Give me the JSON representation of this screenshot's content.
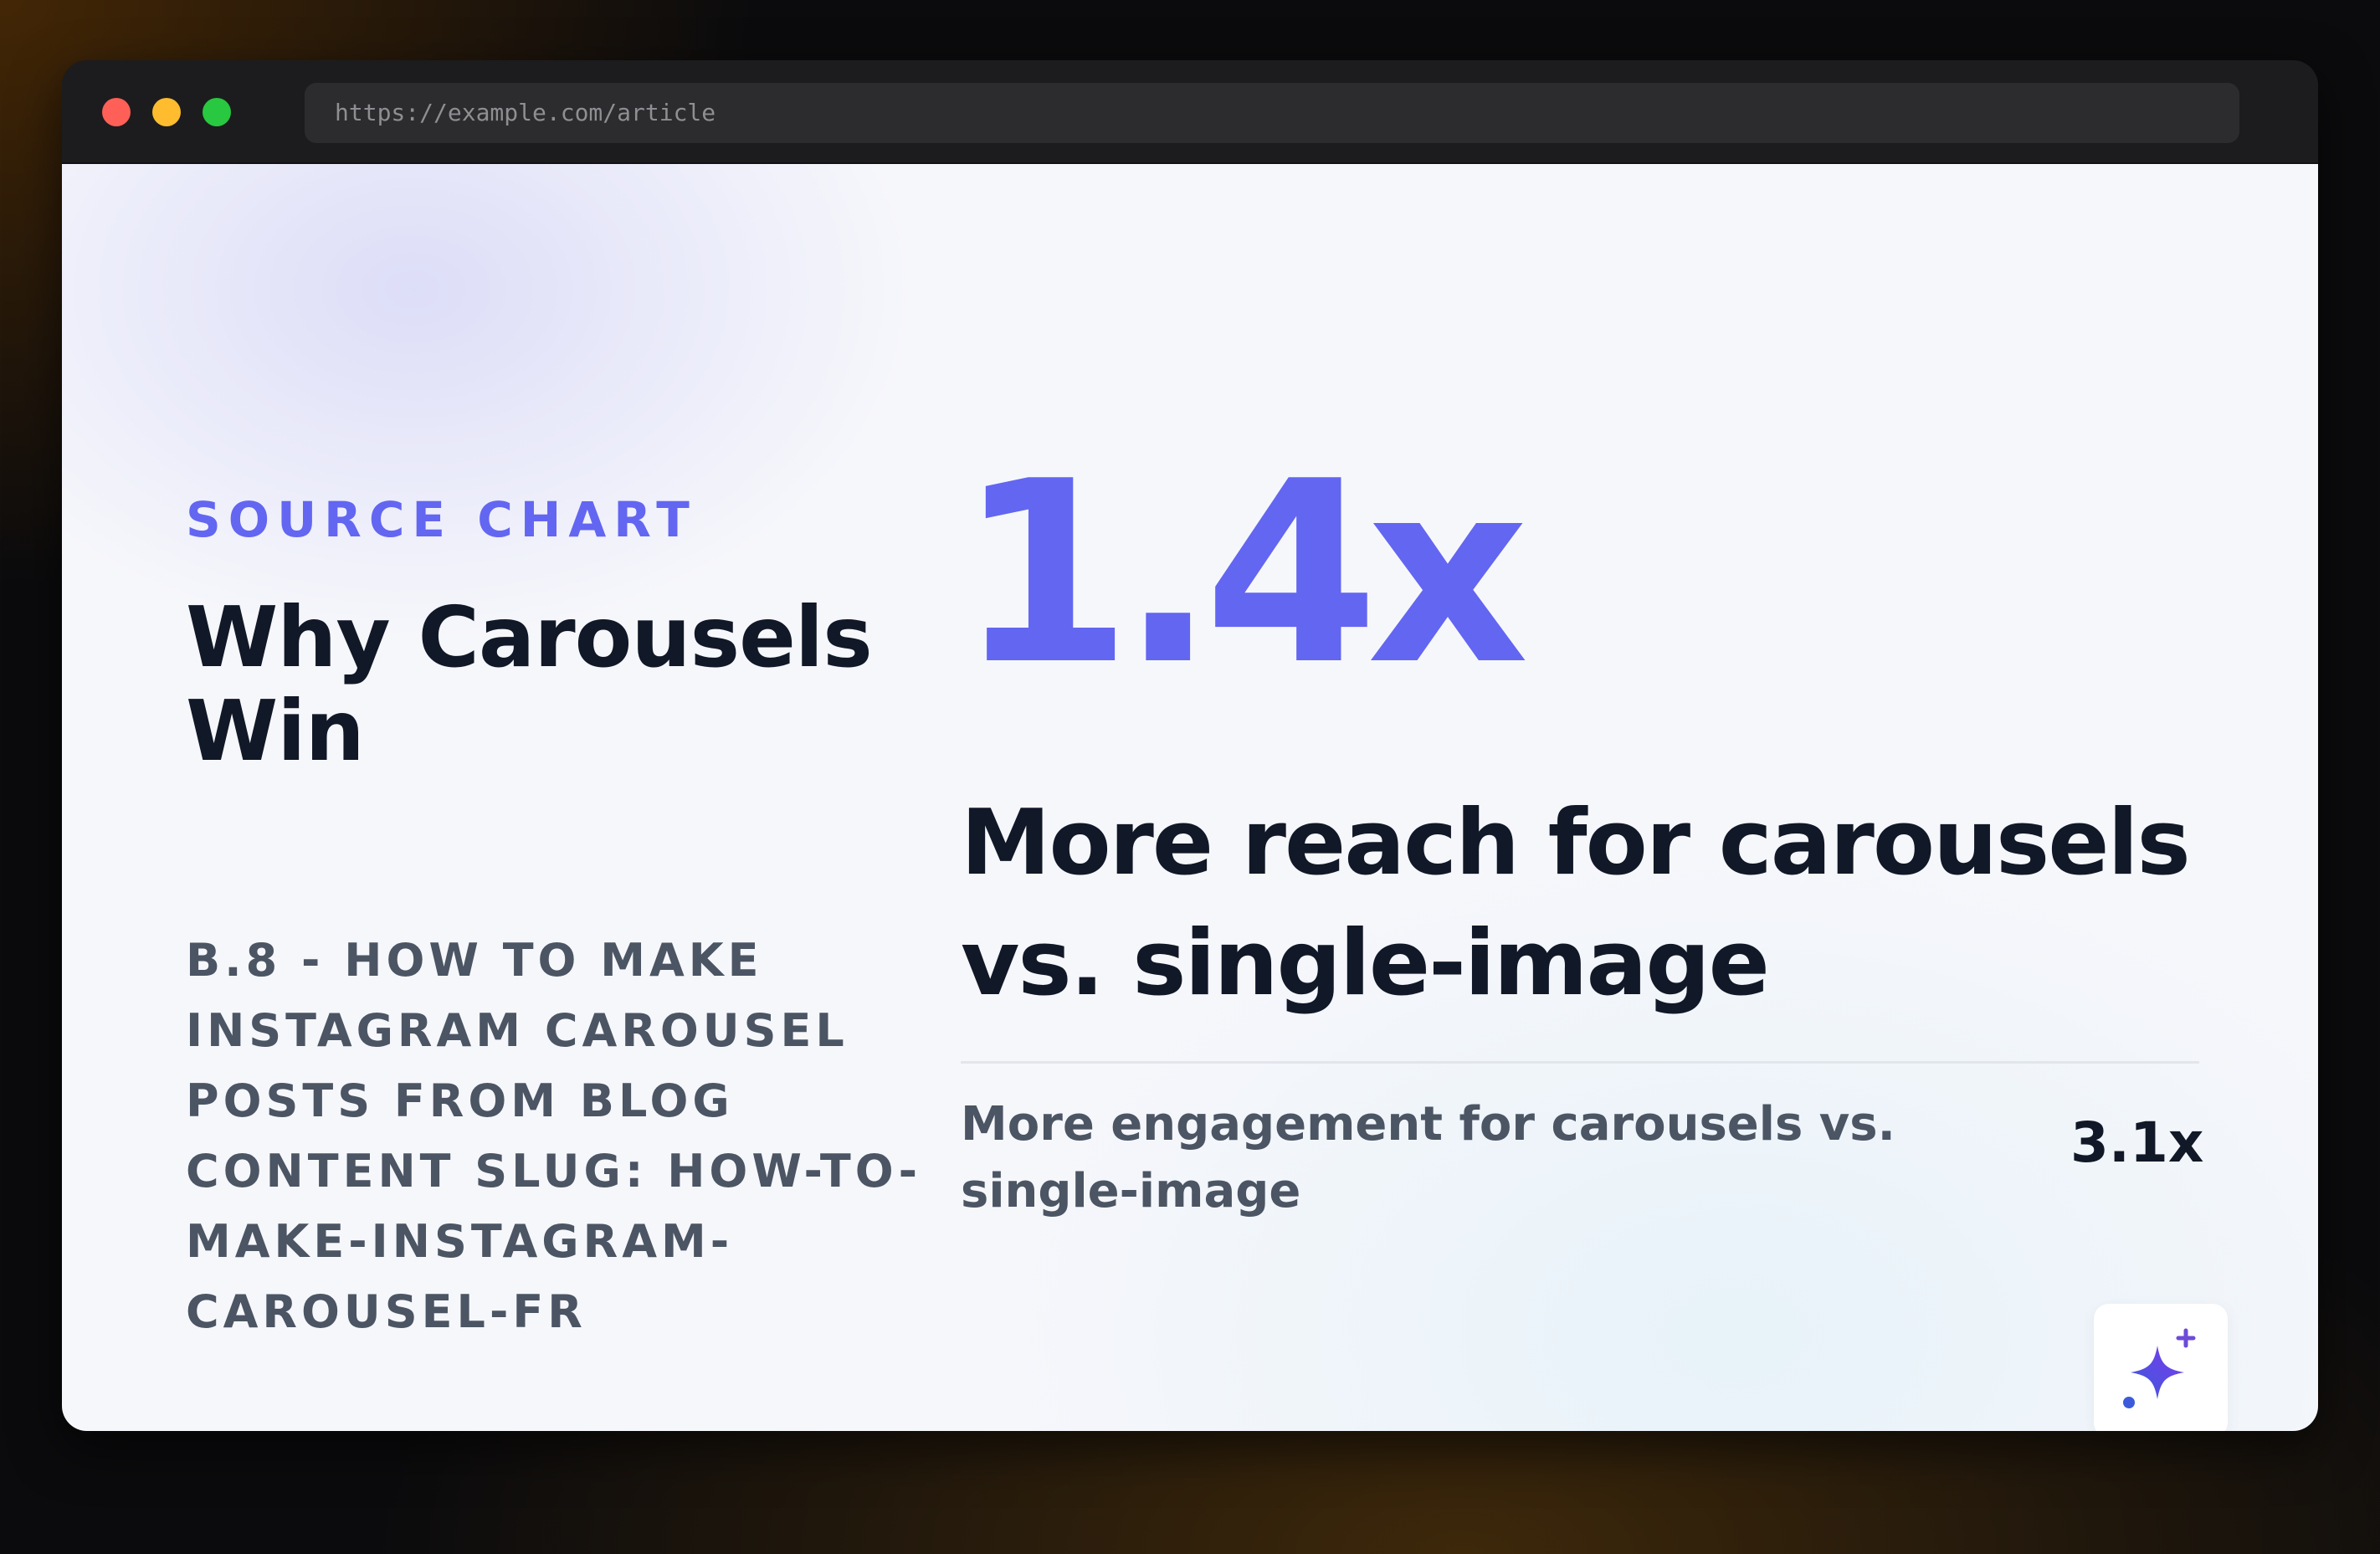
{
  "browser": {
    "url": "https://example.com/article"
  },
  "slide": {
    "eyebrow": "SOURCE CHART",
    "title": "Why Carousels Win",
    "subtitle": "B.8 - How to Make Instagram Carousel Posts from Blog Content Slug: how-to-make-instagram-carousel-fr",
    "big_number": "1.4x",
    "headline": "More reach for carousels vs. single-image",
    "stat": {
      "label": "More engagement for carousels vs. single-image",
      "value": "3.1x"
    },
    "badge_icon": "sparkle-icon"
  },
  "colors": {
    "accent": "#6366f1",
    "heading": "#111827",
    "muted": "#4b5563",
    "sparkle_start": "#3b5bdb",
    "sparkle_end": "#7c3aed"
  }
}
